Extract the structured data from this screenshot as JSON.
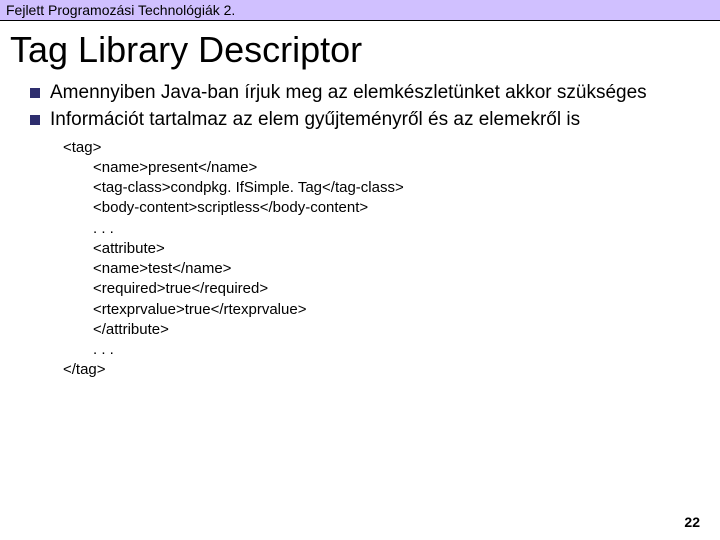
{
  "header": "Fejlett Programozási Technológiák 2.",
  "title": "Tag Library Descriptor",
  "bullets": [
    "Amennyiben Java-ban írjuk meg az elemkészletünket akkor szükséges",
    "Információt tartalmaz az elem gyűjteményről és az elemekről is"
  ],
  "code": {
    "open": "<tag>",
    "lines": [
      "<name>present</name>",
      "<tag-class>condpkg. IfSimple. Tag</tag-class>",
      "<body-content>scriptless</body-content>",
      ". . .",
      "<attribute>",
      "<name>test</name>",
      "<required>true</required>",
      "<rtexprvalue>true</rtexprvalue>",
      "</attribute>",
      ". . ."
    ],
    "close": "</tag>"
  },
  "page_number": "22"
}
